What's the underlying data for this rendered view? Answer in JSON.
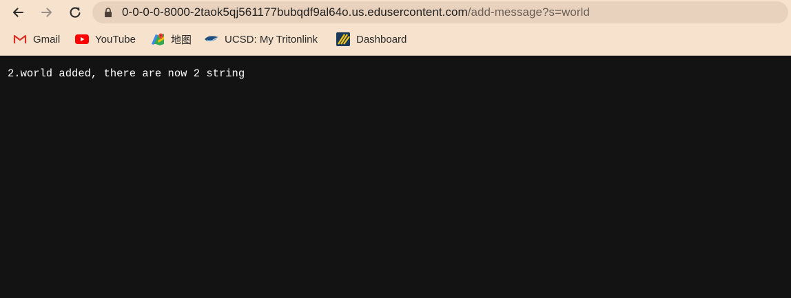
{
  "browser": {
    "nav": {
      "back": "back-arrow-icon",
      "forward": "forward-arrow-icon",
      "reload": "reload-icon"
    },
    "address_bar": {
      "host": "0-0-0-0-8000-2taok5qj561177bubqdf9al64o.us.edusercontent.com",
      "path": "/add-message?s=world",
      "lock_icon": "lock-icon"
    },
    "bookmarks": [
      {
        "label": "Gmail",
        "icon": "gmail-icon"
      },
      {
        "label": "YouTube",
        "icon": "youtube-icon"
      },
      {
        "label": "地图",
        "icon": "maps-icon"
      },
      {
        "label": "UCSD: My Tritonlink",
        "icon": "tritonlink-icon"
      },
      {
        "label": "Dashboard",
        "icon": "dashboard-icon"
      }
    ]
  },
  "page": {
    "body_text": "2.world added, there are now 2 string"
  },
  "colors": {
    "toolbar_bg": "#f6e2cd",
    "omnibox_bg": "#e9d2bd",
    "page_bg": "#131313",
    "page_text": "#ffffff"
  }
}
